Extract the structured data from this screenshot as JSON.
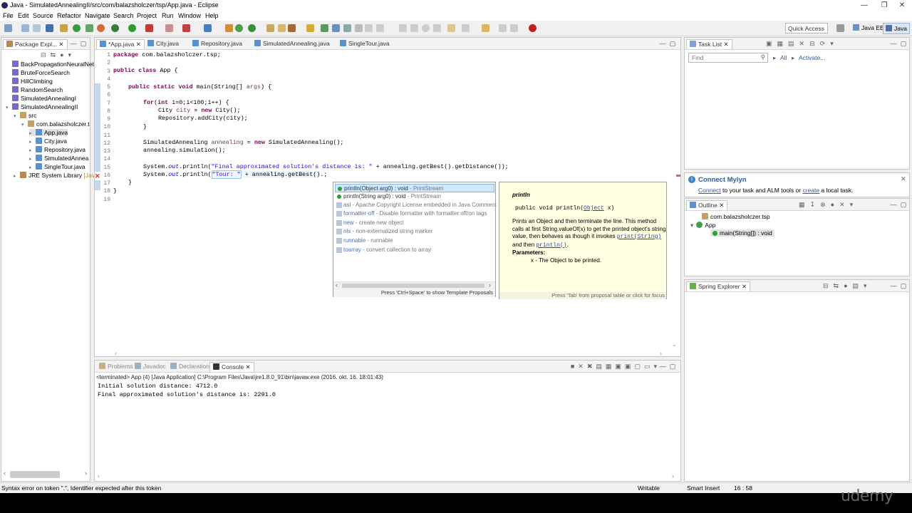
{
  "window": {
    "title": "Java - SimulatedAnnealingII/src/com/balazsholczer/tsp/App.java - Eclipse",
    "controls": [
      "—",
      "❐",
      "✕"
    ]
  },
  "menu": [
    "File",
    "Edit",
    "Source",
    "Refactor",
    "Navigate",
    "Search",
    "Project",
    "Run",
    "Window",
    "Help"
  ],
  "toolbar": {
    "quick_access": "Quick Access",
    "perspectives": [
      "Java EE",
      "Java"
    ]
  },
  "package_explorer": {
    "tab": "Package Expl...",
    "items": [
      {
        "label": "BackPropagationNeuralNet",
        "indent": 0
      },
      {
        "label": "BruteForceSearch",
        "indent": 0
      },
      {
        "label": "HillClimbing",
        "indent": 0
      },
      {
        "label": "RandomSearch",
        "indent": 0
      },
      {
        "label": "SimulatedAnnealingI",
        "indent": 0
      },
      {
        "label": "SimulatedAnnealingII",
        "indent": 0
      },
      {
        "label": "src",
        "indent": 1
      },
      {
        "label": "com.balazsholczer.t",
        "indent": 2
      },
      {
        "label": "App.java",
        "indent": 3
      },
      {
        "label": "City.java",
        "indent": 3
      },
      {
        "label": "Repository.java",
        "indent": 3
      },
      {
        "label": "SimulatedAnnea",
        "indent": 3
      },
      {
        "label": "SingleTour.java",
        "indent": 3
      },
      {
        "label": "JRE System Library",
        "suffix": "[Java",
        "indent": 1
      }
    ]
  },
  "editor": {
    "tabs": [
      "*App.java",
      "City.java",
      "Repository.java",
      "SimulatedAnnealing.java",
      "SingleTour.java"
    ],
    "lines": [
      "1",
      "2",
      "3",
      "4",
      "5",
      "6",
      "7",
      "8",
      "9",
      "10",
      "11",
      "12",
      "13",
      "14",
      "15",
      "16",
      "17",
      "18",
      "19"
    ],
    "code": {
      "l1_kw": "package",
      "l1_rest": " com.balazsholczer.tsp;",
      "l3_kw": "public class",
      "l3_rest": " App {",
      "l5_kw": "public static void",
      "l5_rest": " main(String[] ",
      "l5_var": "args",
      "l5_end": ") {",
      "l7_kw": "for",
      "l7_a": "(",
      "l7_kw2": "int",
      "l7_rest": " i=0;i<100;i++) {",
      "l8_a": "City ",
      "l8_var": "city",
      "l8_b": " = ",
      "l8_kw": "new",
      "l8_c": " City();",
      "l9": "Repository.addCity(city);",
      "l10": "}",
      "l12_a": "SimulatedAnnealing ",
      "l12_var": "annealing",
      "l12_b": " = ",
      "l12_kw": "new",
      "l12_c": " SimulatedAnnealing();",
      "l13": "annealing.simulation();",
      "l15_a": "System.",
      "l15_f": "out",
      "l15_b": ".println(",
      "l15_str": "\"Final approximated solution's distance is: \"",
      "l15_c": " + annealing.getBest().getDistance());",
      "l16_a": "System.",
      "l16_f": "out",
      "l16_b": ".println(",
      "l16_str": "\"Tour: \"",
      "l16_c": " + annealing.getBest()",
      "l16_d": ".;",
      "l17": "}",
      "l18": "}"
    }
  },
  "autocomplete": {
    "items": [
      {
        "label": "println(Object arg0) : void",
        "desc": " - PrintStream"
      },
      {
        "label": "println(String arg0) : void",
        "desc": " - PrintStream"
      },
      {
        "label": "asl",
        "desc": " - Apache Copyright License embedded in Java Comment"
      },
      {
        "label": "formatter-off",
        "desc": " - Disable formatter with formatter:off/on tags"
      },
      {
        "label": "new",
        "desc": " - create new object"
      },
      {
        "label": "nls",
        "desc": " - non-externalized string marker"
      },
      {
        "label": "runnable",
        "desc": " - runnable"
      },
      {
        "label": "toarray",
        "desc": " - convert collection to array"
      }
    ],
    "footer": "Press 'Ctrl+Space' to show Template Proposals"
  },
  "javadoc": {
    "title": "println",
    "signature_a": "public void println(",
    "signature_link": "Object",
    "signature_b": " x)",
    "desc1": "Prints an Object and then terminate the line. This method",
    "desc2": "calls at first String.valueOf(x) to get the printed object's string",
    "desc3a": "value, then behaves as though it invokes ",
    "desc3link": "print(String)",
    "desc4a": "and then ",
    "desc4link": "println()",
    "desc4b": ".",
    "params_label": "Parameters:",
    "param": "x - The Object to be printed.",
    "footer": "Press 'Tab' from proposal table or click for focus"
  },
  "task_list": {
    "tab": "Task List",
    "find_placeholder": "Find",
    "all": "All",
    "activate": "Activate..."
  },
  "mylyn": {
    "title": "Connect Mylyn",
    "connect": "Connect",
    "mid": " to your task and ALM tools or ",
    "create": "create",
    "end": " a local task."
  },
  "outline": {
    "tab": "Outline",
    "items": [
      "com.balazsholczer.tsp",
      "App",
      "main(String[]) : void"
    ]
  },
  "spring": {
    "tab": "Spring Explorer"
  },
  "console": {
    "tabs": [
      "Problems",
      "Javadoc",
      "Declaration",
      "Console"
    ],
    "header": "<terminated> App (4) [Java Application] C:\\Program Files\\Java\\jre1.8.0_91\\bin\\javaw.exe (2016. okt. 16. 18:01:43)",
    "lines": [
      "Initial solution distance: 4712.0",
      "Final approximated solution's distance is: 2291.0"
    ]
  },
  "status": {
    "message": "Syntax error on token \".\", Identifier expected after this token",
    "mode": "Writable",
    "insert": "Smart Insert",
    "position": "16 : 58"
  },
  "watermark": "udemy",
  "colors": {
    "keyword": "#7f0055",
    "string": "#2a00ff",
    "field": "#0000c0",
    "selection": "#cde8ff"
  }
}
